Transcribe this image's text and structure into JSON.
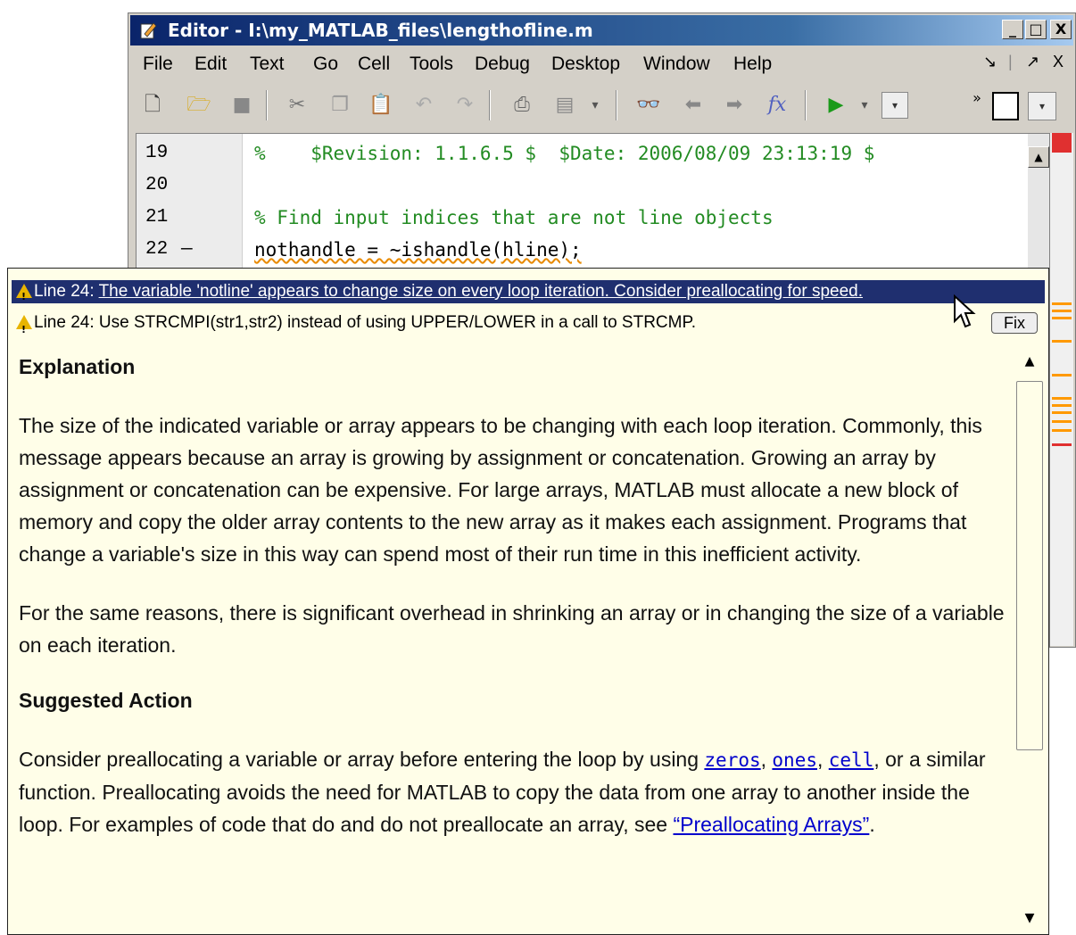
{
  "window": {
    "title": "Editor - I:\\my_MATLAB_files\\lengthofline.m",
    "min_glyph": "_",
    "max_glyph": "□",
    "close_glyph": "X"
  },
  "menu": [
    "File",
    "Edit",
    "Text",
    "Go",
    "Cell",
    "Tools",
    "Debug",
    "Desktop",
    "Window",
    "Help"
  ],
  "dock_controls": [
    "↘",
    "|",
    "↗",
    "X"
  ],
  "toolbar_icons": [
    "new-file-icon",
    "open-folder-icon",
    "save-icon",
    "cut-icon",
    "copy-icon",
    "paste-icon",
    "undo-icon",
    "redo-icon",
    "print-icon",
    "print-options-icon",
    "find-icon",
    "back-icon",
    "forward-icon",
    "function-icon",
    "run-icon",
    "step-dropdown-icon",
    "stack-dropdown-icon",
    "dock-toggle-icon"
  ],
  "code": {
    "lines": [
      {
        "num": "19",
        "dash": "",
        "text": "%    $Revision: 1.1.6.5 $  $Date: 2006/08/09 23:13:19 $",
        "type": "comment"
      },
      {
        "num": "20",
        "dash": "",
        "text": "",
        "type": "blank"
      },
      {
        "num": "21",
        "dash": "",
        "text": "% Find input indices that are not line objects",
        "type": "comment"
      },
      {
        "num": "22",
        "dash": "—",
        "text": "nothandle = ~ishandle(hline);",
        "type": "code"
      }
    ]
  },
  "popup": {
    "messages": [
      {
        "prefix": "Line 24:",
        "text": "The variable 'notline' appears to change size on every loop iteration. Consider preallocating for speed.",
        "selected": true
      },
      {
        "prefix": "Line 24:",
        "text": "Use STRCMPI(str1,str2) instead of using UPPER/LOWER in a call to STRCMP.",
        "selected": false
      }
    ],
    "fix_label": "Fix",
    "explanation_heading": "Explanation",
    "explanation_p1": "The size of the indicated variable or array appears to be changing with each loop iteration. Commonly, this message appears because an array is growing by assignment or concatenation. Growing an array by assignment or concatenation can be expensive. For large arrays, MATLAB must allocate a new block of memory and copy the older array contents to the new array as it makes each assignment. Programs that change a variable's size in this way can spend most of their run time in this inefficient activity.",
    "explanation_p2": "For the same reasons, there is significant overhead in shrinking an array or in changing the size of a variable on each iteration.",
    "suggested_heading": "Suggested Action",
    "suggested_pre": "Consider preallocating a variable or array before entering the loop by using ",
    "fn_zeros": "zeros",
    "sep1": ", ",
    "fn_ones": "ones",
    "sep2": ", ",
    "fn_cell": "cell",
    "suggested_post": ", or a similar function. Preallocating avoids the need for MATLAB to copy the data from one array to another inside the loop. For examples of code that do and do not preallocate an array, see ",
    "ref_link": "“Preallocating Arrays”",
    "suggested_end": "."
  },
  "colors": {
    "selected_message_bg": "#1f2f6f",
    "popup_bg": "#fffee8",
    "comment": "#228b22",
    "link": "#0000cc"
  }
}
